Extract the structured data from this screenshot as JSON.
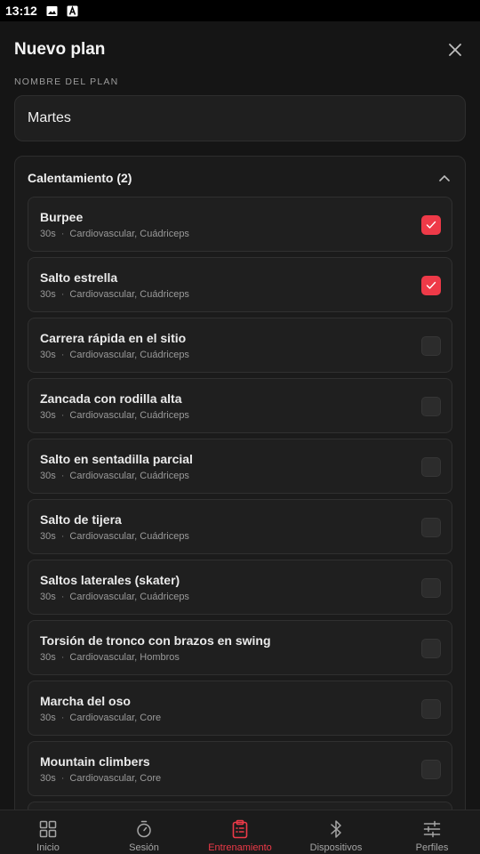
{
  "status": {
    "time": "13:12",
    "icons": [
      "image-icon",
      "text-a-icon"
    ]
  },
  "header": {
    "title": "Nuevo plan",
    "close_icon": "close-icon"
  },
  "plan_name": {
    "label": "NOMBRE DEL PLAN",
    "value": "Martes"
  },
  "section": {
    "title": "Calentamiento (2)",
    "expanded": true,
    "exercises": [
      {
        "name": "Burpee",
        "duration": "30s",
        "muscles": "Cardiovascular, Cuádriceps",
        "checked": true
      },
      {
        "name": "Salto estrella",
        "duration": "30s",
        "muscles": "Cardiovascular, Cuádriceps",
        "checked": true
      },
      {
        "name": "Carrera rápida en el sitio",
        "duration": "30s",
        "muscles": "Cardiovascular, Cuádriceps",
        "checked": false
      },
      {
        "name": "Zancada con rodilla alta",
        "duration": "30s",
        "muscles": "Cardiovascular, Cuádriceps",
        "checked": false
      },
      {
        "name": "Salto en sentadilla parcial",
        "duration": "30s",
        "muscles": "Cardiovascular, Cuádriceps",
        "checked": false
      },
      {
        "name": "Salto de tijera",
        "duration": "30s",
        "muscles": "Cardiovascular, Cuádriceps",
        "checked": false
      },
      {
        "name": "Saltos laterales (skater)",
        "duration": "30s",
        "muscles": "Cardiovascular, Cuádriceps",
        "checked": false
      },
      {
        "name": "Torsión de tronco con brazos en swing",
        "duration": "30s",
        "muscles": "Cardiovascular, Hombros",
        "checked": false
      },
      {
        "name": "Marcha del oso",
        "duration": "30s",
        "muscles": "Cardiovascular, Core",
        "checked": false
      },
      {
        "name": "Mountain climbers",
        "duration": "30s",
        "muscles": "Cardiovascular, Core",
        "checked": false
      }
    ]
  },
  "colors": {
    "accent": "#ee3a48",
    "background": "#151515",
    "card": "#1f1f1f"
  },
  "nav": {
    "items": [
      {
        "label": "Inicio",
        "icon": "grid-icon",
        "active": false
      },
      {
        "label": "Sesión",
        "icon": "stopwatch-icon",
        "active": false
      },
      {
        "label": "Entrenamiento",
        "icon": "clipboard-icon",
        "active": true
      },
      {
        "label": "Dispositivos",
        "icon": "bluetooth-icon",
        "active": false
      },
      {
        "label": "Perfiles",
        "icon": "sliders-icon",
        "active": false
      }
    ]
  }
}
